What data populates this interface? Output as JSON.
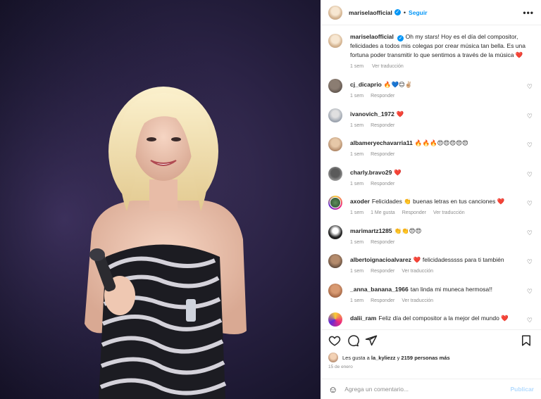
{
  "header": {
    "username": "mariselaofficial",
    "follow_label": "Seguir",
    "dot": "•",
    "more_label": "•••",
    "verified_mark": "✓"
  },
  "caption": {
    "username": "mariselaofficial",
    "text": "Oh my stars! Hoy es el día del compositor, felicidades a todos mis colegas por crear música tan bella. Es una fortuna poder transmitir lo que sentimos a través de la música ❤️",
    "time": "1 sem",
    "translate": "Ver traducción"
  },
  "comments": [
    {
      "user": "cj_dicaprio",
      "text": "🔥💙😊✌🏼",
      "time": "1 sem",
      "reply": "Responder",
      "translate": ""
    },
    {
      "user": "ivanovich_1972",
      "text": "❤️",
      "time": "1 sem",
      "reply": "Responder",
      "translate": ""
    },
    {
      "user": "albameryechavarria11",
      "text": "🔥🔥🔥😍😍😍😍😍",
      "time": "1 sem",
      "reply": "Responder",
      "translate": ""
    },
    {
      "user": "charly.bravo29",
      "text": "❤️",
      "time": "1 sem",
      "reply": "Responder",
      "translate": ""
    },
    {
      "user": "axoder",
      "text": "Felicidades 👏 buenas letras en tus canciones ❤️",
      "time": "1 sem",
      "likes": "1 Me gusta",
      "reply": "Responder",
      "translate": "Ver traducción"
    },
    {
      "user": "marimartz1285",
      "text": "👏👏😍😍",
      "time": "1 sem",
      "reply": "Responder",
      "translate": ""
    },
    {
      "user": "albertoignacioalvarez",
      "text": "❤️ felicidadesssss para ti también",
      "time": "1 sem",
      "reply": "Responder",
      "translate": "Ver traducción"
    },
    {
      "user": "_anna_banana_1966",
      "text": "tan linda mi muneca hermosa!!",
      "time": "1 sem",
      "reply": "Responder",
      "translate": "Ver traducción"
    },
    {
      "user": "dalii_ram",
      "text": "Feliz día del compositor a la mejor del mundo ❤️",
      "time": "",
      "reply": "",
      "translate": ""
    }
  ],
  "heart_glyph": "♡",
  "likes": {
    "prefix": "Les gusta a",
    "user": "la_kyliezz",
    "and": "y",
    "count": "2159 personas más"
  },
  "date": "15 de enero",
  "add_comment": {
    "emoji_glyph": "☺",
    "placeholder": "Agrega un comentario...",
    "publish_label": "Publicar"
  },
  "colors": {
    "accent": "#0095f6",
    "secondary_text": "#8e8e8e",
    "publish_disabled": "#b3dbff"
  }
}
